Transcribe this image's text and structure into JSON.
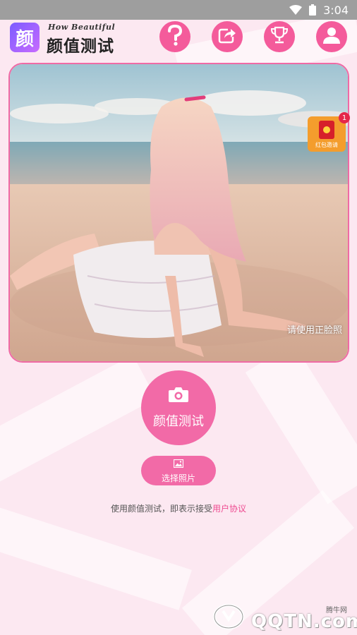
{
  "status_bar": {
    "time": "3:04"
  },
  "header": {
    "logo_glyph": "颜",
    "logo_subtitle": "How Beautiful",
    "logo_title": "颜值测试",
    "icons": [
      "help-icon",
      "share-icon",
      "trophy-icon",
      "user-icon"
    ]
  },
  "photo": {
    "hint": "请使用正脸照"
  },
  "redpack": {
    "label": "红包邀请",
    "badge": "1"
  },
  "actions": {
    "test_label": "颜值测试",
    "select_label": "选择照片"
  },
  "agreement": {
    "text": "使用颜值测试，即表示接受",
    "link": "用户协议"
  },
  "watermark": {
    "small": "腾牛网",
    "text": "QQTN.com"
  },
  "colors": {
    "accent": "#f26aa7",
    "background": "#fce8f1",
    "status_bar": "#9e9e9e"
  }
}
